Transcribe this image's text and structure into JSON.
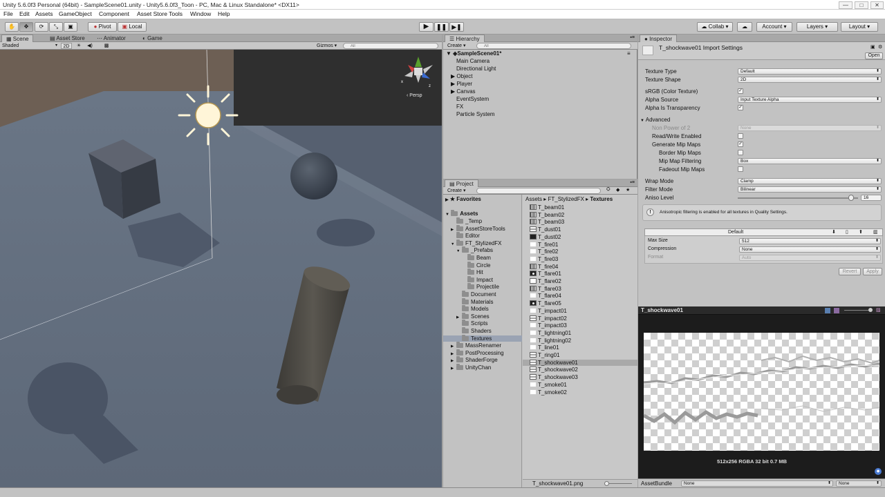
{
  "window": {
    "title": "Unity 5.6.0f3 Personal (64bit) - SampleScene01.unity - Unity5.6.0f3_Toon - PC, Mac & Linux Standalone* <DX11>",
    "minimize": "—",
    "maximize": "□",
    "close": "✕"
  },
  "menu": [
    "File",
    "Edit",
    "Assets",
    "GameObject",
    "Component",
    "Asset Store Tools",
    "Window",
    "Help"
  ],
  "toolbar": {
    "pivot": "Pivot",
    "local": "Local",
    "collab": "Collab ▾",
    "account": "Account ▾",
    "layers": "Layers ▾",
    "layout": "Layout ▾"
  },
  "scene": {
    "tabs": [
      "Scene",
      "Asset Store",
      "Animator",
      "Game"
    ],
    "shading": "Shaded",
    "mode_2d": "2D",
    "gizmos": "Gizmos ▾",
    "search_placeholder": "All",
    "persp": "Persp"
  },
  "hierarchy": {
    "tab": "Hierarchy",
    "create": "Create ▾",
    "search_placeholder": "All",
    "scene_name": "SampleScene01*",
    "items": [
      "Main Camera",
      "Directional Light",
      "Object",
      "Player",
      "Canvas",
      "EventSystem",
      "FX",
      "Particle System"
    ]
  },
  "project": {
    "tab": "Project",
    "create": "Create ▾",
    "favorites": "Favorites",
    "assets": "Assets",
    "tree": [
      {
        "label": "_Temp",
        "level": 2
      },
      {
        "label": "AssetStoreTools",
        "level": 2
      },
      {
        "label": "Editor",
        "level": 2
      },
      {
        "label": "FT_StylizedFX",
        "level": 2
      },
      {
        "label": "_Prefabs",
        "level": 3
      },
      {
        "label": "Beam",
        "level": 4
      },
      {
        "label": "Circle",
        "level": 4
      },
      {
        "label": "Hit",
        "level": 4
      },
      {
        "label": "Impact",
        "level": 4
      },
      {
        "label": "Projectile",
        "level": 4
      },
      {
        "label": "Document",
        "level": 3
      },
      {
        "label": "Materials",
        "level": 3
      },
      {
        "label": "Models",
        "level": 3
      },
      {
        "label": "Scenes",
        "level": 3
      },
      {
        "label": "Scripts",
        "level": 3
      },
      {
        "label": "Shaders",
        "level": 3
      },
      {
        "label": "Textures",
        "level": 3
      },
      {
        "label": "MassRenamer",
        "level": 2
      },
      {
        "label": "PostProcessing",
        "level": 2
      },
      {
        "label": "ShaderForge",
        "level": 2
      },
      {
        "label": "UnityChan",
        "level": 2
      }
    ],
    "breadcrumb": [
      "Assets",
      "FT_StylizedFX",
      "Textures"
    ],
    "files": [
      "T_beam01",
      "T_beam02",
      "T_beam03",
      "T_dust01",
      "T_dust02",
      "T_fire01",
      "T_fire02",
      "T_fire03",
      "T_fire04",
      "T_flare01",
      "T_flare02",
      "T_flare03",
      "T_flare04",
      "T_flare05",
      "T_impact01",
      "T_impact02",
      "T_impact03",
      "T_lightning01",
      "T_lightning02",
      "T_line01",
      "T_ring01",
      "T_shockwave01",
      "T_shockwave02",
      "T_shockwave03",
      "T_smoke01",
      "T_smoke02"
    ],
    "selected_file": "T_shockwave01",
    "footer_file": "T_shockwave01.png"
  },
  "inspector": {
    "tab": "Inspector",
    "title": "T_shockwave01 Import Settings",
    "open": "Open",
    "texture_type": {
      "label": "Texture Type",
      "value": "Default"
    },
    "texture_shape": {
      "label": "Texture Shape",
      "value": "2D"
    },
    "srgb": {
      "label": "sRGB (Color Texture)"
    },
    "alpha_source": {
      "label": "Alpha Source",
      "value": "Input Texture Alpha"
    },
    "alpha_transparency": {
      "label": "Alpha Is Transparency"
    },
    "advanced": "Advanced",
    "non_power": {
      "label": "Non Power of 2",
      "value": "None"
    },
    "read_write": {
      "label": "Read/Write Enabled"
    },
    "gen_mip": {
      "label": "Generate Mip Maps"
    },
    "border_mip": {
      "label": "Border Mip Maps"
    },
    "mip_filter": {
      "label": "Mip Map Filtering",
      "value": "Box"
    },
    "fadeout": {
      "label": "Fadeout Mip Maps"
    },
    "wrap": {
      "label": "Wrap Mode",
      "value": "Clamp"
    },
    "filter": {
      "label": "Filter Mode",
      "value": "Bilinear"
    },
    "aniso": {
      "label": "Aniso Level",
      "value": "16",
      "fraction": 0.94
    },
    "notice": "Anisotropic filtering is enabled for all textures in Quality Settings.",
    "platform": "Default",
    "max_size": {
      "label": "Max Size",
      "value": "512"
    },
    "compression": {
      "label": "Compression",
      "value": "None"
    },
    "format": {
      "label": "Format",
      "value": "Auto"
    },
    "revert": "Revert",
    "apply": "Apply"
  },
  "preview": {
    "title": "T_shockwave01",
    "info": "512x256  RGBA 32 bit   0.7 MB",
    "assetbundle_label": "AssetBundle",
    "assetbundle_value": "None",
    "variant_value": "None"
  }
}
